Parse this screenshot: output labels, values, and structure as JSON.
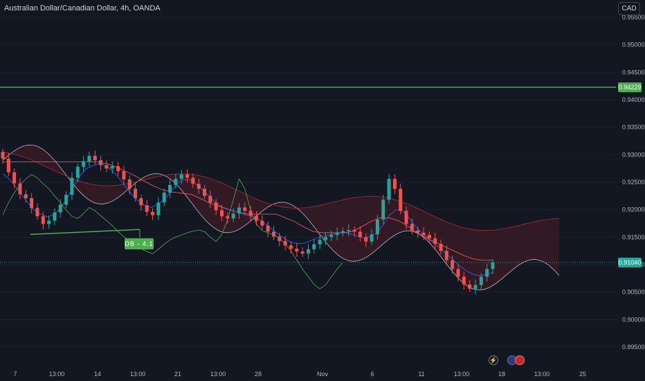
{
  "header": {
    "symbol_title": "Australian Dollar/Canadian Dollar, 4h, OANDA",
    "currency_button": "CAD"
  },
  "price_tags": {
    "resistance_label": "0.94229",
    "last_price_label": "0.91040"
  },
  "pattern_label": "DB - 4.1",
  "colors": {
    "background": "#131722",
    "up_candle": "#26a69a",
    "down_candle": "#ef5350",
    "resistance_line": "#4caf50",
    "kumo_bullish": "#1b3a2b",
    "kumo_bearish": "#4a1e25",
    "kijun": "#ef5350",
    "tenkan": "#2962ff",
    "senkou_a": "#e0e3eb",
    "senkou_b": "#b22833",
    "chikou": "#4caf50",
    "grid": "#1e222d"
  },
  "chart_data": {
    "type": "line",
    "title": "Australian Dollar/Canadian Dollar, 4h, OANDA",
    "indicators": [
      "candles",
      "ichimoku cloud"
    ],
    "y_axis": {
      "ticks": [
        "0.95500",
        "0.95000",
        "0.94500",
        "0.94000",
        "0.93500",
        "0.93000",
        "0.92500",
        "0.92000",
        "0.91500",
        "0.91000",
        "0.90500",
        "0.90000",
        "0.89500"
      ],
      "ylim": [
        0.8935,
        0.9565
      ]
    },
    "x_axis": {
      "ticks": [
        "7",
        "13:00",
        "14",
        "13:00",
        "21",
        "13:00",
        "28",
        "Nov",
        "6",
        "11",
        "13:00",
        "18",
        "13:00",
        "25"
      ]
    },
    "resistance_level": 0.94229,
    "last_price": 0.9104,
    "double_bottom_points": [
      0.9155,
      0.9164
    ],
    "close_series": [
      0.9293,
      0.9268,
      0.9248,
      0.9228,
      0.9221,
      0.9203,
      0.9188,
      0.9174,
      0.918,
      0.9195,
      0.9209,
      0.9227,
      0.9258,
      0.9278,
      0.9288,
      0.9298,
      0.929,
      0.9281,
      0.9275,
      0.9279,
      0.927,
      0.9255,
      0.9238,
      0.9221,
      0.9208,
      0.9196,
      0.919,
      0.9213,
      0.9231,
      0.9245,
      0.9256,
      0.9264,
      0.9258,
      0.9247,
      0.9238,
      0.9225,
      0.9213,
      0.9199,
      0.9188,
      0.9184,
      0.9193,
      0.9204,
      0.9198,
      0.9189,
      0.918,
      0.9171,
      0.916,
      0.9151,
      0.9143,
      0.9135,
      0.9129,
      0.9124,
      0.912,
      0.9128,
      0.9137,
      0.9145,
      0.915,
      0.9154,
      0.9158,
      0.9161,
      0.9163,
      0.916,
      0.915,
      0.9142,
      0.9155,
      0.9182,
      0.9218,
      0.9256,
      0.9238,
      0.9198,
      0.9174,
      0.9162,
      0.9158,
      0.9154,
      0.9148,
      0.9138,
      0.9125,
      0.9108,
      0.9092,
      0.9078,
      0.9064,
      0.9056,
      0.9063,
      0.9078,
      0.9092,
      0.9104
    ],
    "tenkan_series": [
      0.9265,
      0.9256,
      0.9242,
      0.9226,
      0.9211,
      0.9198,
      0.9191,
      0.9187,
      0.9192,
      0.9203,
      0.9221,
      0.9242,
      0.9262,
      0.9275,
      0.928,
      0.9284,
      0.928,
      0.9271,
      0.9258,
      0.9242,
      0.9228,
      0.9216,
      0.9208,
      0.9204,
      0.9209,
      0.9218,
      0.9232,
      0.9247,
      0.9255,
      0.9254,
      0.9246,
      0.9236,
      0.9224,
      0.9213,
      0.9205,
      0.9201,
      0.9197,
      0.9193,
      0.919,
      0.9186,
      0.918,
      0.9172,
      0.9162,
      0.9153,
      0.9145,
      0.914,
      0.9138,
      0.914,
      0.9145,
      0.9149,
      0.9152,
      0.9155,
      0.9157,
      0.9158,
      0.9156,
      0.9152,
      0.9149,
      0.9151,
      0.9158,
      0.9172,
      0.919,
      0.92,
      0.9198,
      0.9185,
      0.917,
      0.9158,
      0.9148,
      0.9138,
      0.9128,
      0.9118,
      0.9107,
      0.9096,
      0.9088,
      0.9082,
      0.908,
      0.9082,
      0.9086
    ],
    "kijun_series": [
      0.9287,
      0.9287,
      0.9287,
      0.9287,
      0.9287,
      0.9287,
      0.9287,
      0.9287,
      0.9287,
      0.9287,
      0.9287,
      0.9284,
      0.9278,
      0.927,
      0.9262,
      0.9252,
      0.9243,
      0.9236,
      0.9232,
      0.923,
      0.9228,
      0.922,
      0.9212,
      0.9206,
      0.92,
      0.9195,
      0.9192,
      0.9192,
      0.9192,
      0.9192,
      0.9185,
      0.9178,
      0.9168,
      0.916,
      0.9158,
      0.9158,
      0.9158,
      0.916,
      0.9168,
      0.9178,
      0.9185,
      0.9185,
      0.918,
      0.917,
      0.9158,
      0.9148,
      0.914,
      0.9132,
      0.9124,
      0.9116,
      0.911,
      0.9108,
      0.9108
    ]
  }
}
